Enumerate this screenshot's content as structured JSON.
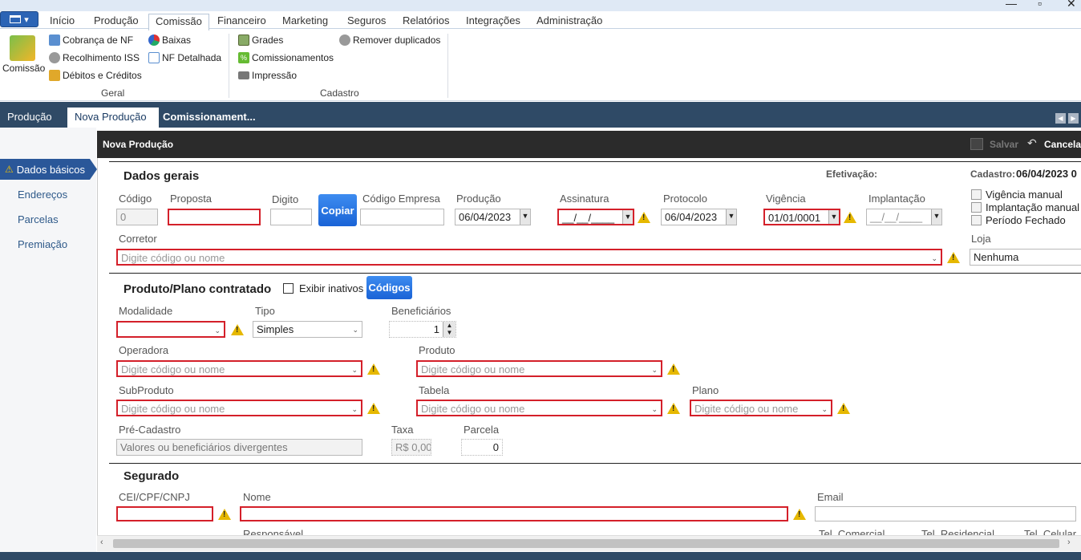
{
  "window": {
    "minimize": "—",
    "maximize": "▫",
    "close": "✕"
  },
  "ribbon_tabs": [
    "Início",
    "Produção",
    "Comissão",
    "Financeiro",
    "Marketing",
    "Seguros",
    "Relatórios",
    "Integrações",
    "Administração"
  ],
  "ribbon": {
    "big_button": "Comissão",
    "geral": {
      "label": "Geral",
      "items": [
        "Cobrança de NF",
        "Recolhimento ISS",
        "Débitos e Créditos",
        "Baixas",
        "NF Detalhada"
      ]
    },
    "cadastro": {
      "label": "Cadastro",
      "items": [
        "Grades",
        "Comissionamentos",
        "Impressão",
        "Remover duplicados"
      ]
    }
  },
  "doc_tabs": [
    "Produção",
    "Nova Produção",
    "Comissionament..."
  ],
  "sidebar": [
    "Dados básicos",
    "Endereços",
    "Parcelas",
    "Premiação"
  ],
  "panel": {
    "title": "Nova Produção",
    "save": "Salvar",
    "cancel": "Cancelar"
  },
  "dados_gerais": {
    "title": "Dados gerais",
    "efetivacao_label": "Efetivação:",
    "cadastro_label": "Cadastro:",
    "cadastro_value": "06/04/2023 0",
    "codigo_label": "Código",
    "codigo": "0",
    "proposta_label": "Proposta",
    "digito_label": "Digito",
    "copiar": "Copiar",
    "codigo_empresa_label": "Código Empresa",
    "producao_label": "Produção",
    "producao": "06/04/2023",
    "assinatura_label": "Assinatura",
    "assinatura": "__/__/____",
    "protocolo_label": "Protocolo",
    "protocolo": "06/04/2023",
    "vigencia_label": "Vigência",
    "vigencia": "01/01/0001",
    "implantacao_label": "Implantação",
    "implantacao": "__/__/____",
    "checks": [
      "Vigência manual",
      "Implantação manual",
      "Período Fechado"
    ],
    "corretor_label": "Corretor",
    "corretor_ph": "Digite código ou nome",
    "loja_label": "Loja",
    "loja": "Nenhuma"
  },
  "produto": {
    "title": "Produto/Plano contratado",
    "exibir_inativos": "Exibir inativos",
    "codigos": "Códigos",
    "modalidade_label": "Modalidade",
    "tipo_label": "Tipo",
    "tipo": "Simples",
    "beneficiarios_label": "Beneficiários",
    "beneficiarios": "1",
    "operadora_label": "Operadora",
    "produto_label": "Produto",
    "subproduto_label": "SubProduto",
    "tabela_label": "Tabela",
    "plano_label": "Plano",
    "ph": "Digite código ou nome",
    "precadastro_label": "Pré-Cadastro",
    "precadastro": "Valores ou beneficiários divergentes",
    "taxa_label": "Taxa",
    "taxa": "R$ 0,00",
    "parcela_label": "Parcela",
    "parcela": "0"
  },
  "segurado": {
    "title": "Segurado",
    "cpf_label": "CEI/CPF/CNPJ",
    "nome_label": "Nome",
    "email_label": "Email",
    "responsavel_label": "Responsável",
    "tel_comercial": "Tel. Comercial",
    "tel_residencial": "Tel. Residencial",
    "tel_celular": "Tel. Celular"
  }
}
